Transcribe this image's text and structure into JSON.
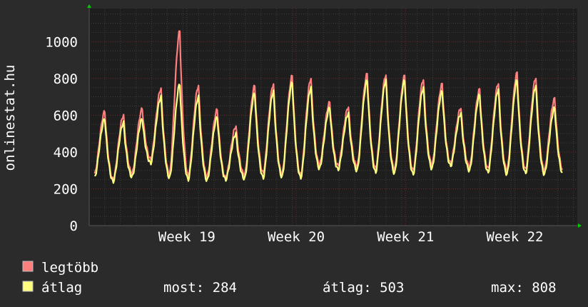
{
  "colors": {
    "background": "#2b2b2b",
    "plot_background": "#1e1e1e",
    "grid_minor": "#3c3c3c",
    "grid_major": "#6e2a2a",
    "axis_arrow": "#00cc00",
    "text": "#ffffff",
    "max_series": "#ff7f7f",
    "avg_series": "#ffff7f"
  },
  "chart_data": {
    "type": "line",
    "title": "",
    "ylabel": "onlinestat.hu",
    "xlabel": "",
    "ylim": [
      0,
      1180
    ],
    "y_ticks": [
      0,
      200,
      400,
      600,
      800,
      1000
    ],
    "x_range_days": [
      0,
      31.25
    ],
    "x_tick_labels": [
      {
        "label": "Week 19",
        "day": 6.25
      },
      {
        "label": "Week 20",
        "day": 13.25
      },
      {
        "label": "Week 21",
        "day": 20.25
      },
      {
        "label": "Week 22",
        "day": 27.25
      }
    ],
    "grid": true,
    "legend_position": "bottom-left",
    "series": [
      {
        "name": "legtöbb",
        "color": "#ff7f7f",
        "daily_peaks": [
          620,
          600,
          635,
          745,
          1060,
          760,
          630,
          540,
          760,
          770,
          815,
          800,
          670,
          645,
          825,
          820,
          815,
          795,
          770,
          640,
          740,
          775,
          830,
          805,
          690
        ],
        "daily_troughs": [
          280,
          250,
          285,
          360,
          280,
          270,
          265,
          260,
          275,
          285,
          280,
          275,
          330,
          325,
          320,
          310,
          305,
          300,
          330,
          340,
          320,
          310,
          300,
          305,
          300
        ]
      },
      {
        "name": "átlag",
        "color": "#ffff7f",
        "daily_peaks": [
          580,
          560,
          580,
          700,
          770,
          700,
          590,
          500,
          720,
          730,
          780,
          750,
          640,
          610,
          790,
          790,
          790,
          750,
          730,
          610,
          710,
          740,
          790,
          760,
          640
        ],
        "daily_troughs": [
          260,
          240,
          265,
          340,
          260,
          250,
          245,
          250,
          255,
          260,
          265,
          260,
          310,
          305,
          300,
          290,
          285,
          280,
          310,
          325,
          300,
          290,
          280,
          285,
          280
        ]
      }
    ]
  },
  "legend": {
    "max_label": "legtöbb",
    "avg_label": "átlag",
    "now_text": "most: 284",
    "avg_text": "átlag: 503",
    "max_text": "max: 808"
  }
}
